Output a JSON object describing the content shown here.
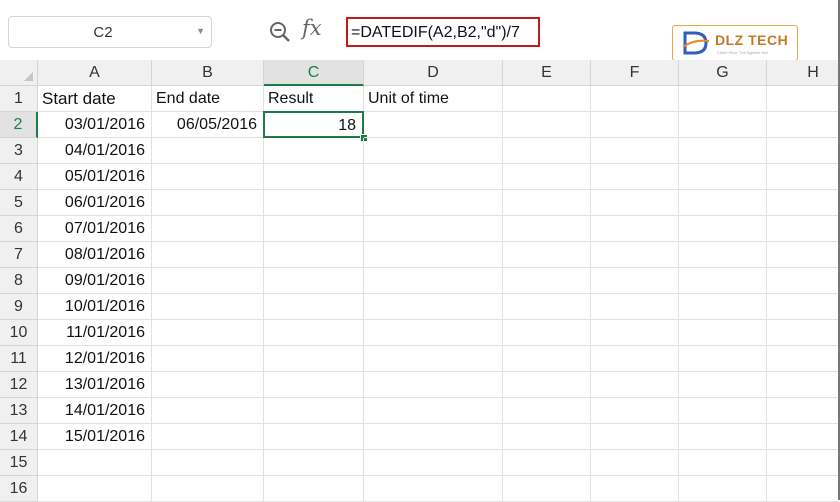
{
  "name_box": {
    "value": "C2"
  },
  "formula_bar": {
    "fx_label": "fx",
    "formula": "=DATEDIF(A2,B2,\"d\")/7"
  },
  "logo": {
    "brand": "DLZ TECH",
    "tagline": "Chinh Phuc Trai Nghiem Moi"
  },
  "columns": [
    "A",
    "B",
    "C",
    "D",
    "E",
    "F",
    "G",
    "H"
  ],
  "active_column": "C",
  "active_row": "2",
  "rows": [
    "1",
    "2",
    "3",
    "4",
    "5",
    "6",
    "7",
    "8",
    "9",
    "10",
    "11",
    "12",
    "13",
    "14",
    "15",
    "16"
  ],
  "cells": {
    "A1": "Start date",
    "B1": "End date",
    "C1": "Result",
    "D1": "Unit of time",
    "A2": "03/01/2016",
    "B2": "06/05/2016",
    "C2": "18",
    "A3": "04/01/2016",
    "A4": "05/01/2016",
    "A5": "06/01/2016",
    "A6": "07/01/2016",
    "A7": "08/01/2016",
    "A8": "09/01/2016",
    "A9": "10/01/2016",
    "A10": "11/01/2016",
    "A11": "12/01/2016",
    "A12": "13/01/2016",
    "A13": "14/01/2016",
    "A14": "15/01/2016"
  },
  "colors": {
    "selection": "#1e7b45",
    "formula_highlight": "#c21a1a",
    "header_bg": "#f0f0f0"
  }
}
